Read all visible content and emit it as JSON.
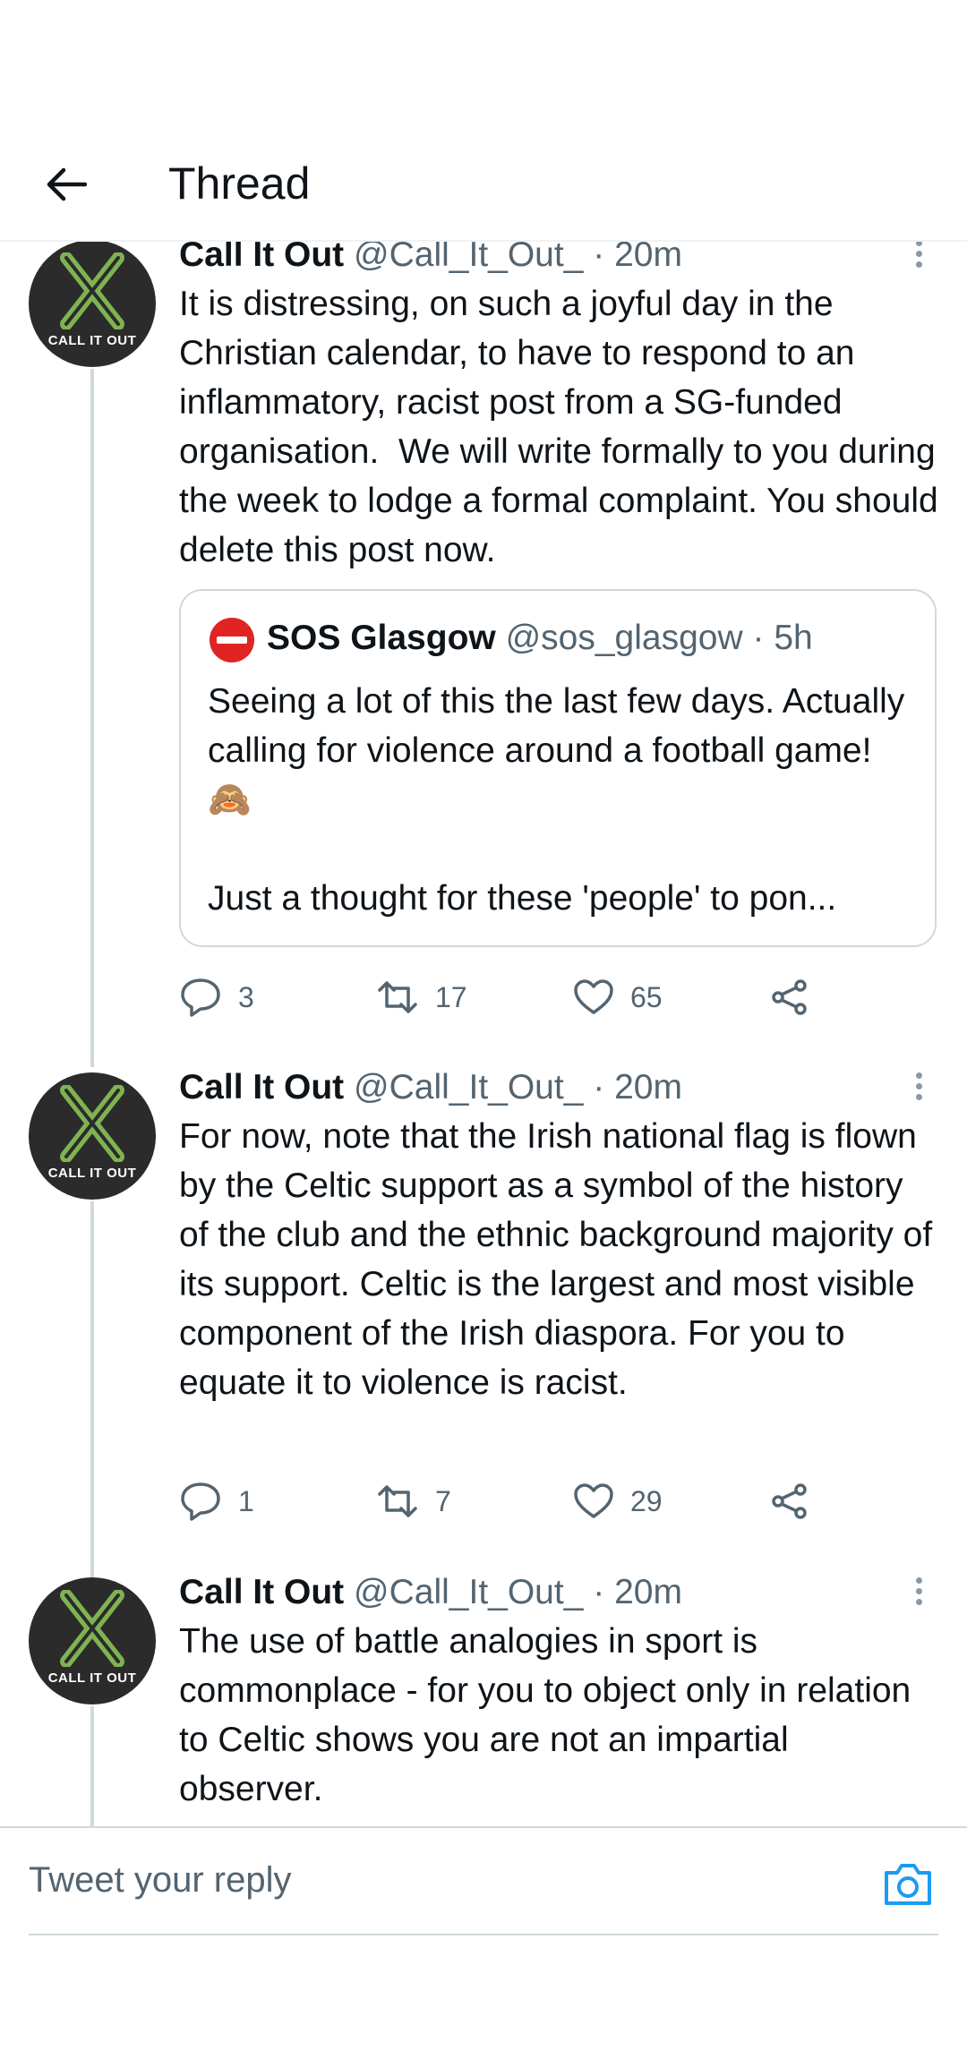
{
  "header": {
    "title": "Thread"
  },
  "tweets": [
    {
      "name": "Call It Out",
      "handle": "@Call_It_Out_",
      "dot": "·",
      "time": "20m",
      "avatar_text": "CALL IT OUT",
      "text": "It is distressing, on such a joyful day in the Christian calendar, to have to respond to an inflammatory, racist post from a SG-funded organisation.  We will write formally to you during the week to lodge a formal complaint. You should delete this post now.",
      "quote": {
        "name": "SOS Glasgow",
        "handle": "@sos_glasgow",
        "dot": "·",
        "time": "5h",
        "text": "Seeing a lot of this the last few days. Actually calling for violence around a football game! 🙈\n\nJust a thought for these 'people' to pon..."
      },
      "replies": "3",
      "retweets": "17",
      "likes": "65"
    },
    {
      "name": "Call It Out",
      "handle": "@Call_It_Out_",
      "dot": "·",
      "time": "20m",
      "avatar_text": "CALL IT OUT",
      "text": "For now, note that the Irish national flag is flown by the Celtic support as a symbol of the history of the club and the ethnic background majority of its support. Celtic is the largest and most visible component of the Irish diaspora. For you to equate it to violence is racist.",
      "replies": "1",
      "retweets": "7",
      "likes": "29"
    },
    {
      "name": "Call It Out",
      "handle": "@Call_It_Out_",
      "dot": "·",
      "time": "20m",
      "avatar_text": "CALL IT OUT",
      "text": "The use of battle analogies in sport is commonplace - for you to object only in relation to Celtic shows you are not an impartial observer."
    }
  ],
  "reply_bar": {
    "placeholder": "Tweet your reply"
  },
  "colors": {
    "secondary": "#536471",
    "accent": "#1d9bf0",
    "border": "#cfd9de",
    "avatar_x": "#7fb352"
  },
  "icons": [
    "back-arrow-icon",
    "more-icon",
    "reply-icon",
    "retweet-icon",
    "like-icon",
    "share-icon",
    "camera-icon"
  ]
}
